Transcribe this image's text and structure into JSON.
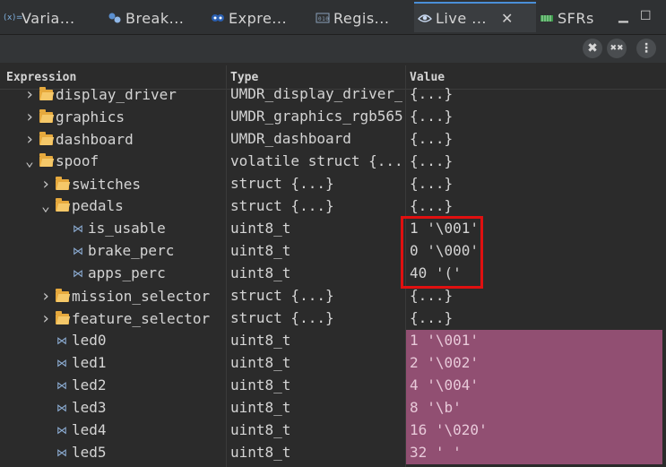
{
  "tabs": [
    {
      "label": "Varia...",
      "icon": "variables-icon"
    },
    {
      "label": "Break...",
      "icon": "breakpoints-icon"
    },
    {
      "label": "Expre...",
      "icon": "expressions-icon"
    },
    {
      "label": "Regis...",
      "icon": "registers-icon"
    },
    {
      "label": "Live ...",
      "icon": "live-expressions-icon",
      "active": true
    },
    {
      "label": "SFRs",
      "icon": "sfrs-icon"
    }
  ],
  "toolbar": {
    "remove_label": "✖",
    "remove_all_label": "✖✖",
    "menu_label": "⋮"
  },
  "columns": {
    "expression": "Expression",
    "type": "Type",
    "value": "Value"
  },
  "rows": [
    {
      "name": "display_driver",
      "type": "UMDR_display_driver_",
      "value": "{...}",
      "kind": "folder",
      "expand": "collapsed",
      "indent": 1
    },
    {
      "name": "graphics",
      "type": "UMDR_graphics_rgb565",
      "value": "{...}",
      "kind": "folder",
      "expand": "collapsed",
      "indent": 1
    },
    {
      "name": "dashboard",
      "type": "UMDR_dashboard",
      "value": "{...}",
      "kind": "folder",
      "expand": "collapsed",
      "indent": 1
    },
    {
      "name": "spoof",
      "type": "volatile struct {...",
      "value": "{...}",
      "kind": "folder",
      "expand": "expanded",
      "indent": 1
    },
    {
      "name": "switches",
      "type": "struct {...}",
      "value": "{...}",
      "kind": "folder",
      "expand": "collapsed",
      "indent": 2
    },
    {
      "name": "pedals",
      "type": "struct {...}",
      "value": "{...}",
      "kind": "folder",
      "expand": "expanded",
      "indent": 2
    },
    {
      "name": "is_usable",
      "type": "uint8_t",
      "value": "1 '\\001'",
      "kind": "var",
      "indent": 3
    },
    {
      "name": "brake_perc",
      "type": "uint8_t",
      "value": "0 '\\000'",
      "kind": "var",
      "indent": 3
    },
    {
      "name": "apps_perc",
      "type": "uint8_t",
      "value": "40 '('",
      "kind": "var",
      "indent": 3
    },
    {
      "name": "mission_selector",
      "type": "struct {...}",
      "value": "{...}",
      "kind": "folder",
      "expand": "collapsed",
      "indent": 2
    },
    {
      "name": "feature_selector",
      "type": "struct {...}",
      "value": "{...}",
      "kind": "folder",
      "expand": "collapsed",
      "indent": 2
    },
    {
      "name": "led0",
      "type": "uint8_t",
      "value": "1 '\\001'",
      "kind": "var",
      "indent": 2,
      "changed": true
    },
    {
      "name": "led1",
      "type": "uint8_t",
      "value": "2 '\\002'",
      "kind": "var",
      "indent": 2,
      "changed": true
    },
    {
      "name": "led2",
      "type": "uint8_t",
      "value": "4 '\\004'",
      "kind": "var",
      "indent": 2,
      "changed": true
    },
    {
      "name": "led3",
      "type": "uint8_t",
      "value": "8 '\\b'",
      "kind": "var",
      "indent": 2,
      "changed": true
    },
    {
      "name": "led4",
      "type": "uint8_t",
      "value": "16 '\\020'",
      "kind": "var",
      "indent": 2,
      "changed": true
    },
    {
      "name": "led5",
      "type": "uint8_t",
      "value": "32 ' '",
      "kind": "var",
      "indent": 2,
      "changed": true
    }
  ],
  "colors": {
    "changed_bg": "#914f72",
    "highlight": "#e01010",
    "active_tab": "#4a8fd8"
  }
}
